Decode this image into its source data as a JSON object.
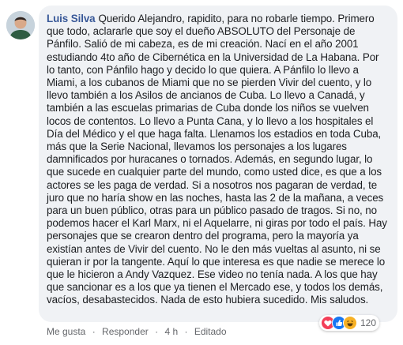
{
  "comment": {
    "author": "Luis Silva",
    "text": "Querido Alejandro, rapidito, para no robarle tiempo. Primero que todo, aclararle que soy el dueño ABSOLUTO del Personaje de Pánfilo. Salió de mi cabeza, es de mi creación. Nací en el año 2001 estudiando 4to año de Cibernética en la Universidad de La Habana. Por lo tanto, con Pánfilo hago y decido lo que quiera. A Pánfilo lo llevo a Miami, a los cubanos de Miami que no se pierden Vivir del cuento, y lo llevo también a los Asilos de ancianos de Cuba. Lo llevo a Canadá, y también a las escuelas primarias de Cuba donde los niños se vuelven locos de contentos. Lo llevo a Punta Cana, y lo llevo a los hospitales el Día del Médico y el que haga falta. Llenamos los estadios en toda Cuba, más que la Serie Nacional, llevamos los personajes a los lugares damnificados por huracanes o tornados. Además, en segundo lugar, lo que sucede en cualquier parte del mundo, como usted dice, es que a los actores se les paga de verdad. Si a nosotros nos pagaran de verdad, te juro que no haría show en las noches, hasta las 2 de la mañana, a veces para un buen público, otras para un público pasado de tragos. Si no, no podemos hacer el Karl Marx, ni el Aquelarre, ni giras por todo el país. Hay personajes que se crearon dentro del programa, pero la mayoría ya existían antes de Vivir del cuento. No le den más vueltas al asunto, ni se quieran ir por la tangente. Aquí lo que interesa es que nadie se merece lo que le hicieron a Andy Vazquez. Ese video no tenía nada. A los que hay que sancionar es a los que ya tienen el Mercado ese, y todos los demás, vacíos, desabastecidos. Nada de esto hubiera sucedido. Mis saludos."
  },
  "actions": {
    "like": "Me gusta",
    "reply": "Responder",
    "time": "4 h",
    "edited": "Editado",
    "separator": "·"
  },
  "reactions": {
    "count": "120",
    "icons": [
      "love-icon",
      "like-icon",
      "haha-icon"
    ],
    "colors": {
      "love": "#f33e58",
      "like": "#1877f2",
      "haha": "#f7b125"
    }
  }
}
